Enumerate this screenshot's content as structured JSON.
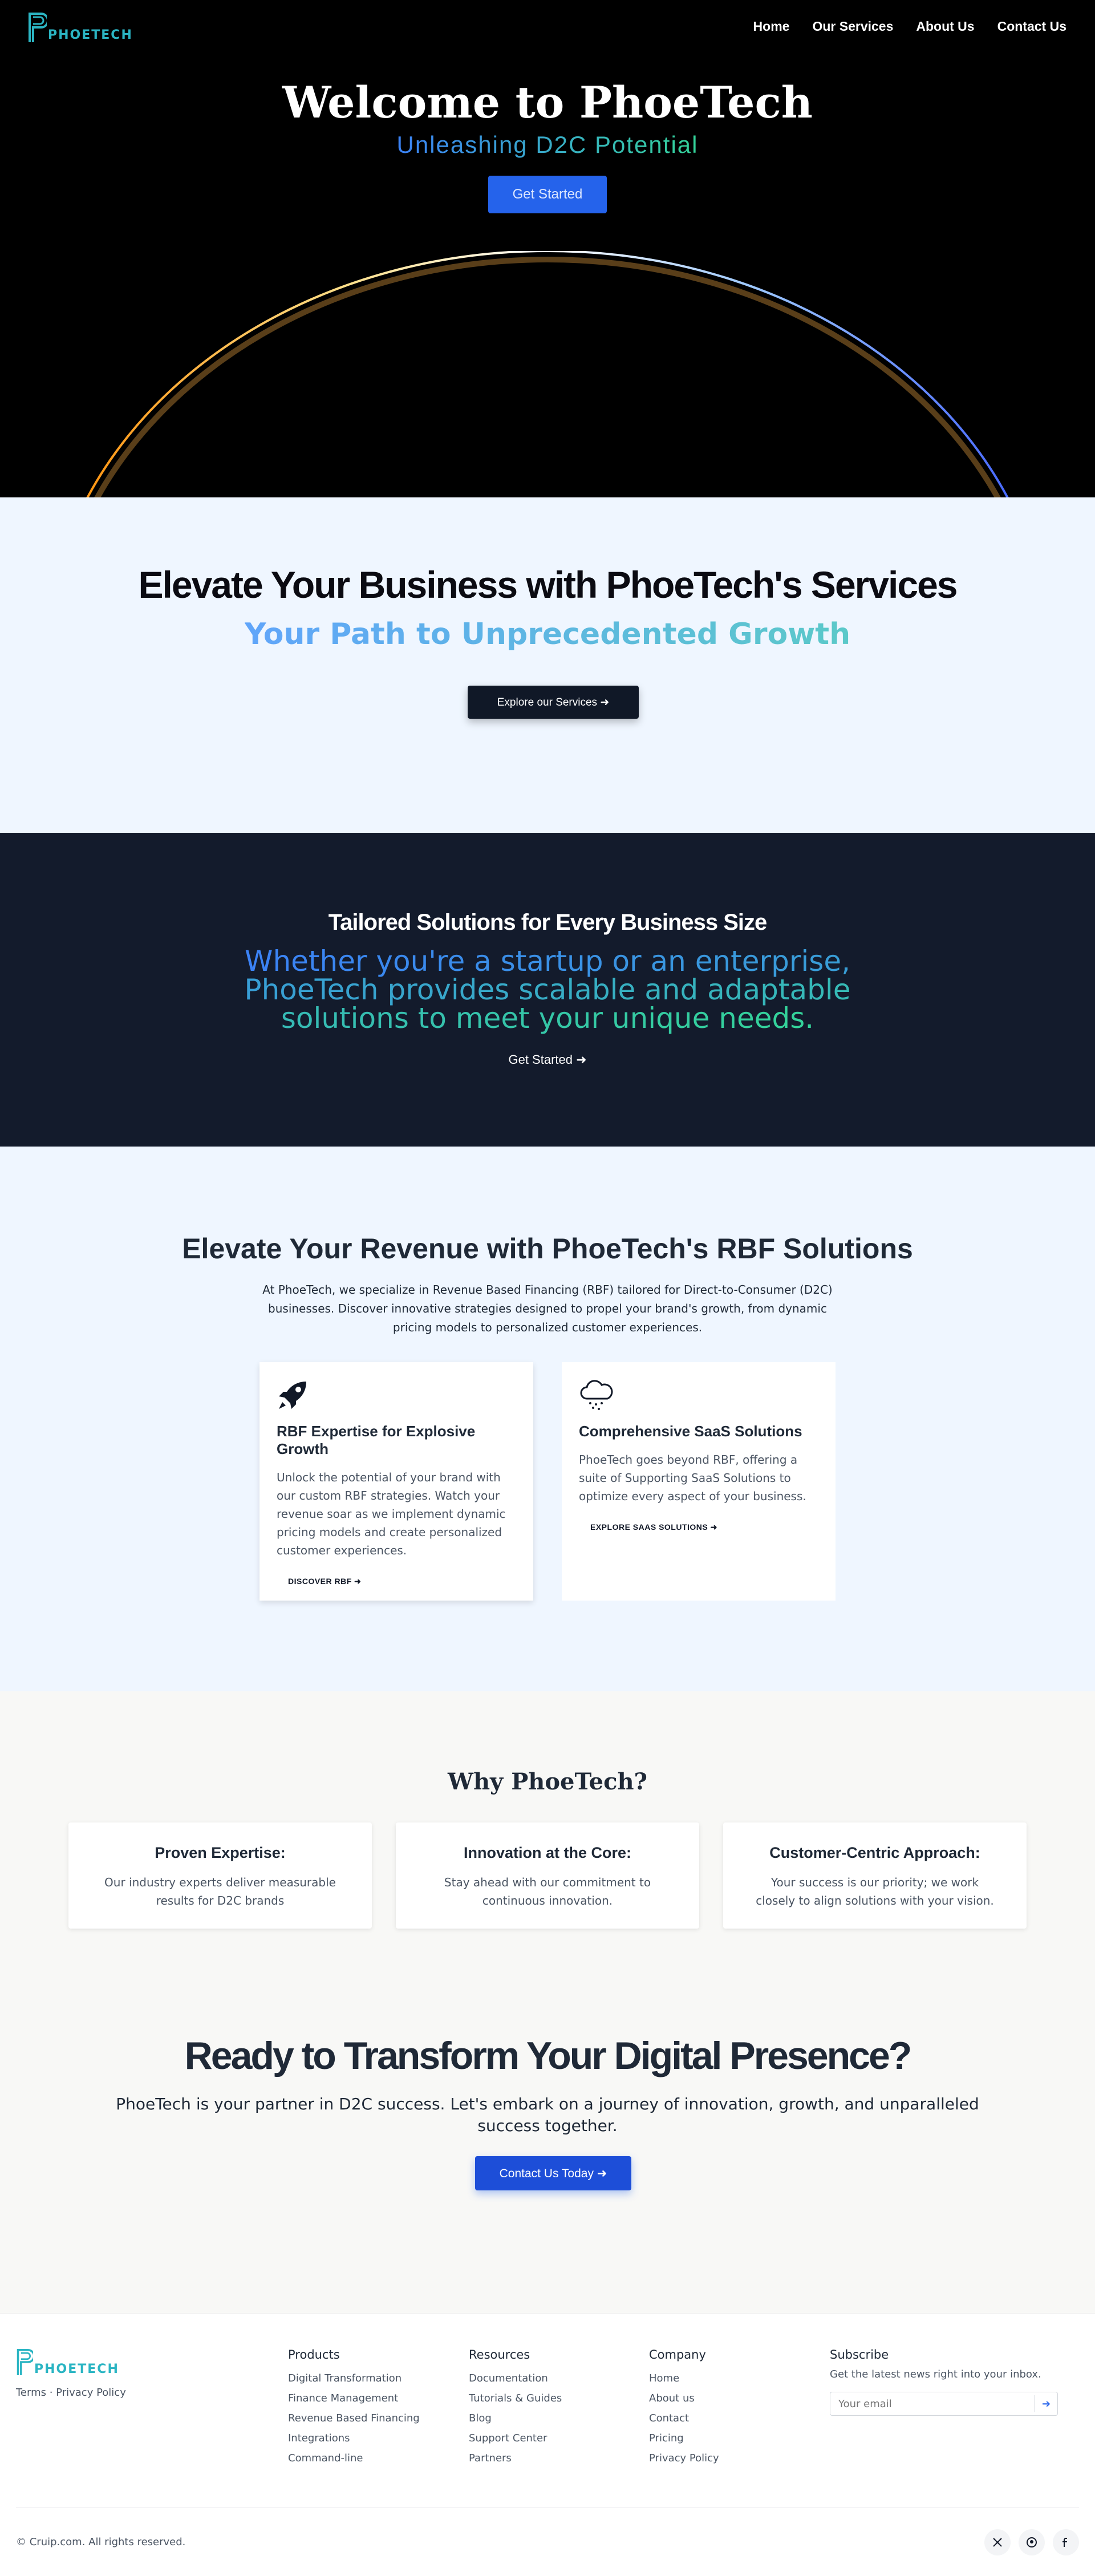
{
  "brand": {
    "name": "PHOETECH",
    "color": "#2bb5c3"
  },
  "nav": {
    "items": [
      "Home",
      "Our Services",
      "About Us",
      "Contact Us"
    ]
  },
  "hero": {
    "title": "Welcome to PhoeTech",
    "subtitle": "Unleashing D2C Potential",
    "button": "Get Started"
  },
  "services": {
    "title": "Elevate Your Business with PhoeTech's Services",
    "subtitle": "Your Path to Unprecedented Growth",
    "button": "Explore our Services ➜"
  },
  "tailored": {
    "title": "Tailored Solutions for Every Business Size",
    "text": "Whether you're a startup or an enterprise, PhoeTech provides scalable and adaptable solutions to meet your unique needs.",
    "link": "Get Started ➜"
  },
  "rbf": {
    "title": "Elevate Your Revenue with PhoeTech's RBF Solutions",
    "text": "At PhoeTech, we specialize in Revenue Based Financing (RBF) tailored for Direct-to-Consumer (D2C) businesses. Discover innovative strategies designed to propel your brand's growth, from dynamic pricing models to personalized customer experiences.",
    "cards": [
      {
        "icon": "rocket-icon",
        "title": "RBF Expertise for Explosive Growth",
        "text": "Unlock the potential of your brand with our custom RBF strategies. Watch your revenue soar as we implement dynamic pricing models and create personalized customer experiences.",
        "link": "DISCOVER RBF ➜"
      },
      {
        "icon": "cloud-icon",
        "title": "Comprehensive SaaS Solutions",
        "text": "PhoeTech goes beyond RBF, offering a suite of Supporting SaaS Solutions to optimize every aspect of your business.",
        "link": "EXPLORE SAAS SOLUTIONS ➜"
      }
    ]
  },
  "why": {
    "title": "Why PhoeTech?",
    "cards": [
      {
        "title": "Proven Expertise:",
        "text": "Our industry experts deliver measurable results for D2C brands"
      },
      {
        "title": "Innovation at the Core:",
        "text": "Stay ahead with our commitment to continuous innovation."
      },
      {
        "title": "Customer-Centric Approach:",
        "text": "Your success is our priority; we work closely to align solutions with your vision."
      }
    ]
  },
  "cta": {
    "title": "Ready to Transform Your Digital Presence?",
    "text": "PhoeTech is your partner in D2C success. Let's embark on a journey of innovation, growth, and unparalleled success together.",
    "button": "Contact Us Today ➜"
  },
  "footer": {
    "legal": "Terms · Privacy Policy",
    "columns": [
      {
        "title": "Products",
        "links": [
          "Digital Transformation",
          "Finance Management",
          "Revenue Based Financing",
          "Integrations",
          "Command-line"
        ]
      },
      {
        "title": "Resources",
        "links": [
          "Documentation",
          "Tutorials & Guides",
          "Blog",
          "Support Center",
          "Partners"
        ]
      },
      {
        "title": "Company",
        "links": [
          "Home",
          "About us",
          "Contact",
          "Pricing",
          "Privacy Policy"
        ]
      }
    ],
    "subscribe": {
      "title": "Subscribe",
      "text": "Get the latest news right into your inbox.",
      "placeholder": "Your email"
    },
    "copyright": "© Cruip.com. All rights reserved.",
    "social": [
      "x-icon",
      "github-icon",
      "facebook-icon"
    ]
  },
  "colors": {
    "accent_blue": "#2563eb",
    "dark_navy": "#131b2c",
    "light_blue_bg": "#eff6ff",
    "gradient_from": "#3b82f6",
    "gradient_to": "#34d399"
  }
}
